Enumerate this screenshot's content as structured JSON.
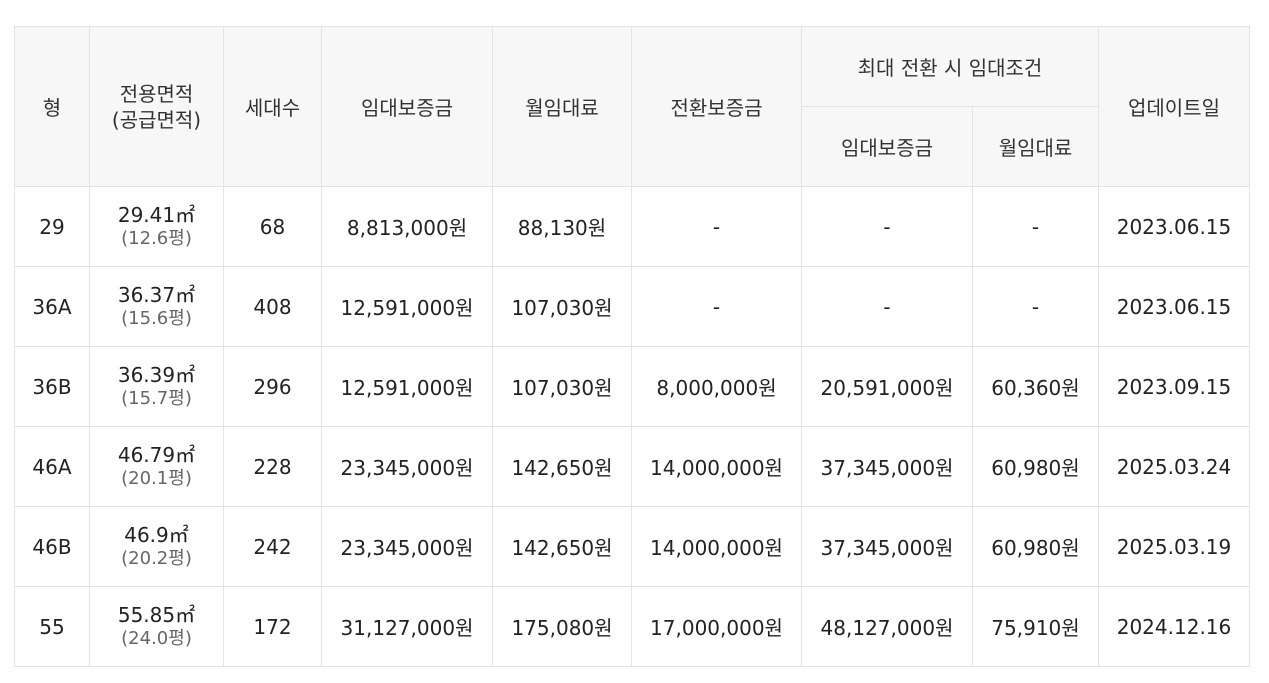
{
  "table": {
    "headers": {
      "type": "형",
      "area_line1": "전용면적",
      "area_line2": "(공급면적)",
      "households": "세대수",
      "deposit": "임대보증금",
      "monthly_rent": "월임대료",
      "conversion_deposit": "전환보증금",
      "max_conversion_group": "최대 전환 시 임대조건",
      "max_deposit": "임대보증금",
      "max_monthly_rent": "월임대료",
      "updated": "업데이트일"
    },
    "rows": [
      {
        "type": "29",
        "area": "29.41㎡",
        "supply": "(12.6평)",
        "households": "68",
        "deposit": "8,813,000원",
        "rent": "88,130원",
        "conversion": "-",
        "max_deposit": "-",
        "max_rent": "-",
        "updated": "2023.06.15"
      },
      {
        "type": "36A",
        "area": "36.37㎡",
        "supply": "(15.6평)",
        "households": "408",
        "deposit": "12,591,000원",
        "rent": "107,030원",
        "conversion": "-",
        "max_deposit": "-",
        "max_rent": "-",
        "updated": "2023.06.15"
      },
      {
        "type": "36B",
        "area": "36.39㎡",
        "supply": "(15.7평)",
        "households": "296",
        "deposit": "12,591,000원",
        "rent": "107,030원",
        "conversion": "8,000,000원",
        "max_deposit": "20,591,000원",
        "max_rent": "60,360원",
        "updated": "2023.09.15"
      },
      {
        "type": "46A",
        "area": "46.79㎡",
        "supply": "(20.1평)",
        "households": "228",
        "deposit": "23,345,000원",
        "rent": "142,650원",
        "conversion": "14,000,000원",
        "max_deposit": "37,345,000원",
        "max_rent": "60,980원",
        "updated": "2025.03.24"
      },
      {
        "type": "46B",
        "area": "46.9㎡",
        "supply": "(20.2평)",
        "households": "242",
        "deposit": "23,345,000원",
        "rent": "142,650원",
        "conversion": "14,000,000원",
        "max_deposit": "37,345,000원",
        "max_rent": "60,980원",
        "updated": "2025.03.19"
      },
      {
        "type": "55",
        "area": "55.85㎡",
        "supply": "(24.0평)",
        "households": "172",
        "deposit": "31,127,000원",
        "rent": "175,080원",
        "conversion": "17,000,000원",
        "max_deposit": "48,127,000원",
        "max_rent": "75,910원",
        "updated": "2024.12.16"
      }
    ]
  }
}
